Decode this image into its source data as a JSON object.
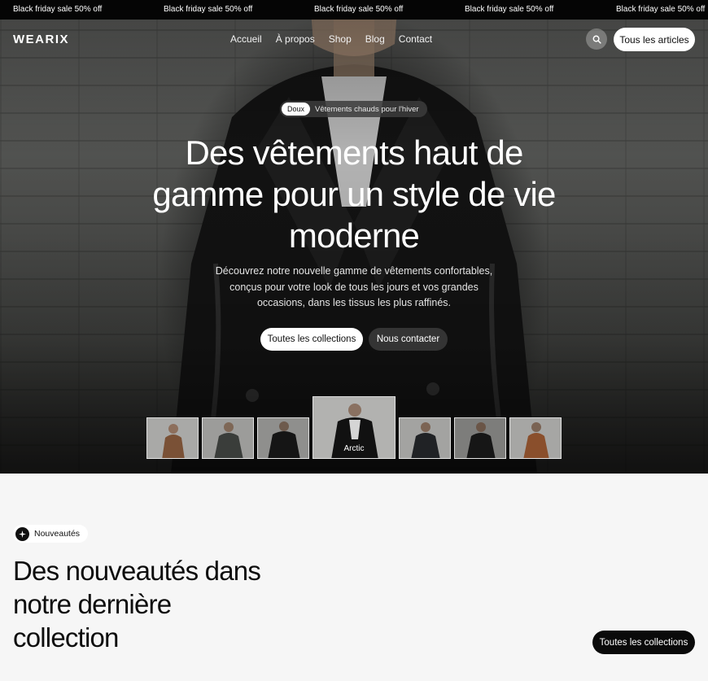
{
  "ticker": {
    "items": [
      "Black friday sale 50% off",
      "Black friday sale 50% off",
      "Black friday sale 50% off",
      "Black friday sale 50% off",
      "Black friday sale 50% off"
    ]
  },
  "nav": {
    "logo": "WEARIX",
    "links": [
      "Accueil",
      "À propos",
      "Shop",
      "Blog",
      "Contact"
    ],
    "search_icon": "search-icon",
    "cta_label": "Tous les articles"
  },
  "hero": {
    "badge_pill": "Doux",
    "badge_text": "Vêtements chauds pour l'hiver",
    "headline": "Des vêtements haut de gamme pour un style de vie moderne",
    "subtext": "Découvrez notre nouvelle gamme de vêtements confortables, conçus pour votre look de tous les jours et vos grandes occasions, dans les tissus les plus raffinés.",
    "primary_button": "Toutes les collections",
    "secondary_button": "Nous contacter",
    "thumbnails": {
      "active_caption": "Arctic"
    }
  },
  "section": {
    "chip_label": "Nouveautés",
    "chip_icon": "sparkle-icon",
    "title": "Des nouveautés dans notre dernière collection",
    "button": "Toutes les collections"
  },
  "colors": {
    "ticker_bg": "#050505",
    "accent_dark": "#0a0a0a",
    "page_bg": "#f6f6f6"
  }
}
